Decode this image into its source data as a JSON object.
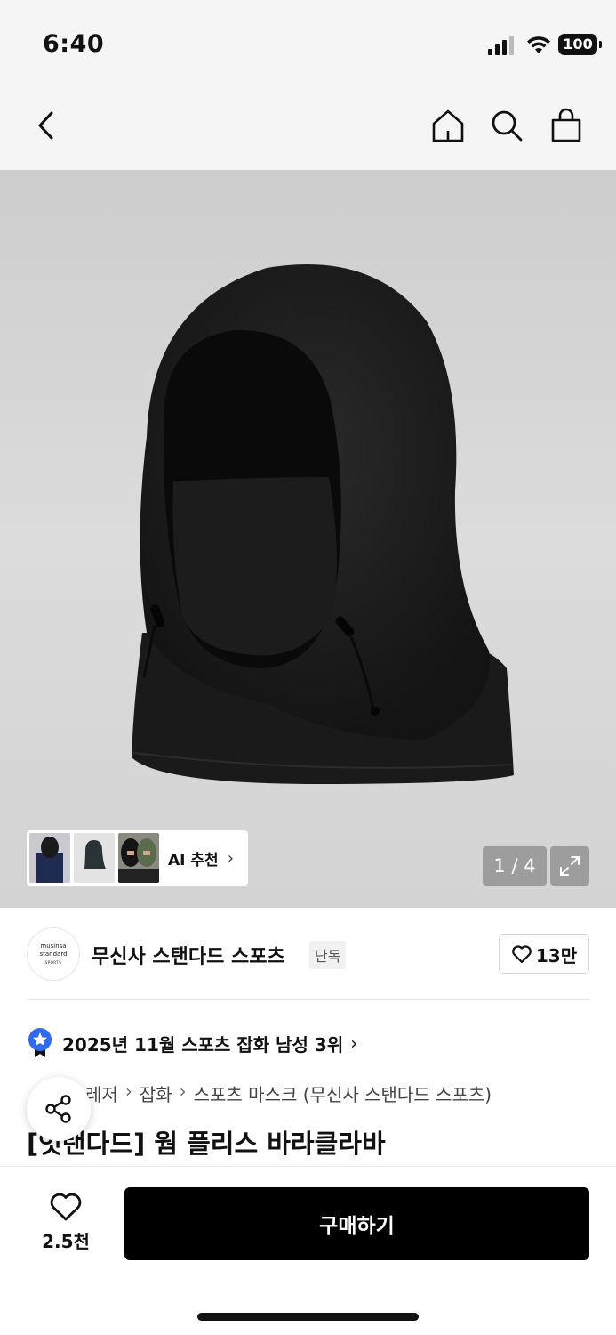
{
  "status_bar": {
    "time": "6:40",
    "battery": "100"
  },
  "gallery": {
    "counter": "1 / 4",
    "ai_label": "AI 추천"
  },
  "brand": {
    "logo_line1": "musinsa",
    "logo_line2": "standard",
    "logo_line3": "SPORTS",
    "name": "무신사 스탠다드 스포츠",
    "badge": "단독",
    "likes": "13만"
  },
  "ranking": {
    "text": "2025년 11월 스포츠 잡화 남성 3위"
  },
  "breadcrumb": [
    "레저",
    "잡화",
    "스포츠 마스크 (무신사 스탠다드 스포츠)"
  ],
  "product": {
    "title": "[엇탠다드] 웜 플리스 바라클라바"
  },
  "bottom": {
    "wish_count": "2.5천",
    "buy_label": "구매하기"
  },
  "colors": {
    "accent_blue": "#2f6bf0",
    "buy_bg": "#000000"
  }
}
